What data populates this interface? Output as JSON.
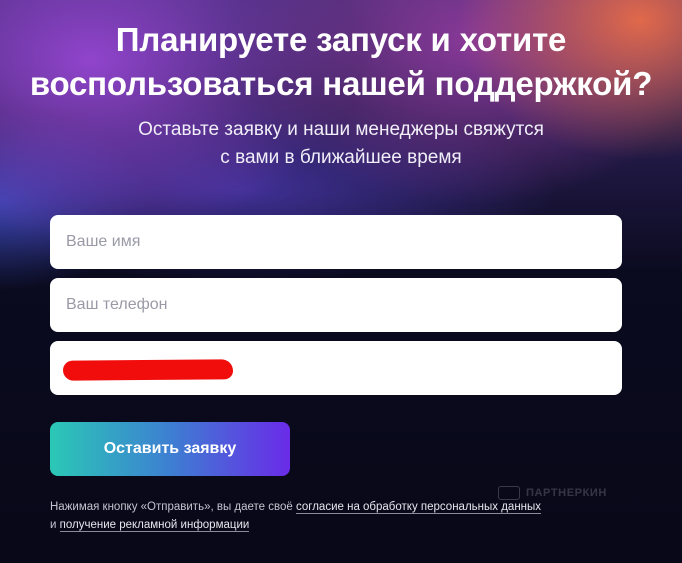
{
  "header": {
    "title_line1": "Планируете запуск и хотите",
    "title_line2": "воспользоваться нашей поддержкой?",
    "subtitle_line1": "Оставьте заявку и наши менеджеры свяжутся",
    "subtitle_line2": "с вами в ближайшее время"
  },
  "form": {
    "name_placeholder": "Ваше имя",
    "phone_placeholder": "Ваш телефон",
    "email_placeholder": "",
    "submit_label": "Оставить заявку"
  },
  "consent": {
    "text_start": "Нажимая кнопку «Отправить», вы даете своё ",
    "link1": "согласие на обработку персональных данных",
    "and": "и ",
    "link2": "получение рекламной информации"
  },
  "watermark": {
    "text": "ПАРТНЕРКИН"
  },
  "colors": {
    "redaction": "#f20d0d",
    "button_gradient_start": "#2bc8b6",
    "button_gradient_end": "#6a2be8"
  }
}
